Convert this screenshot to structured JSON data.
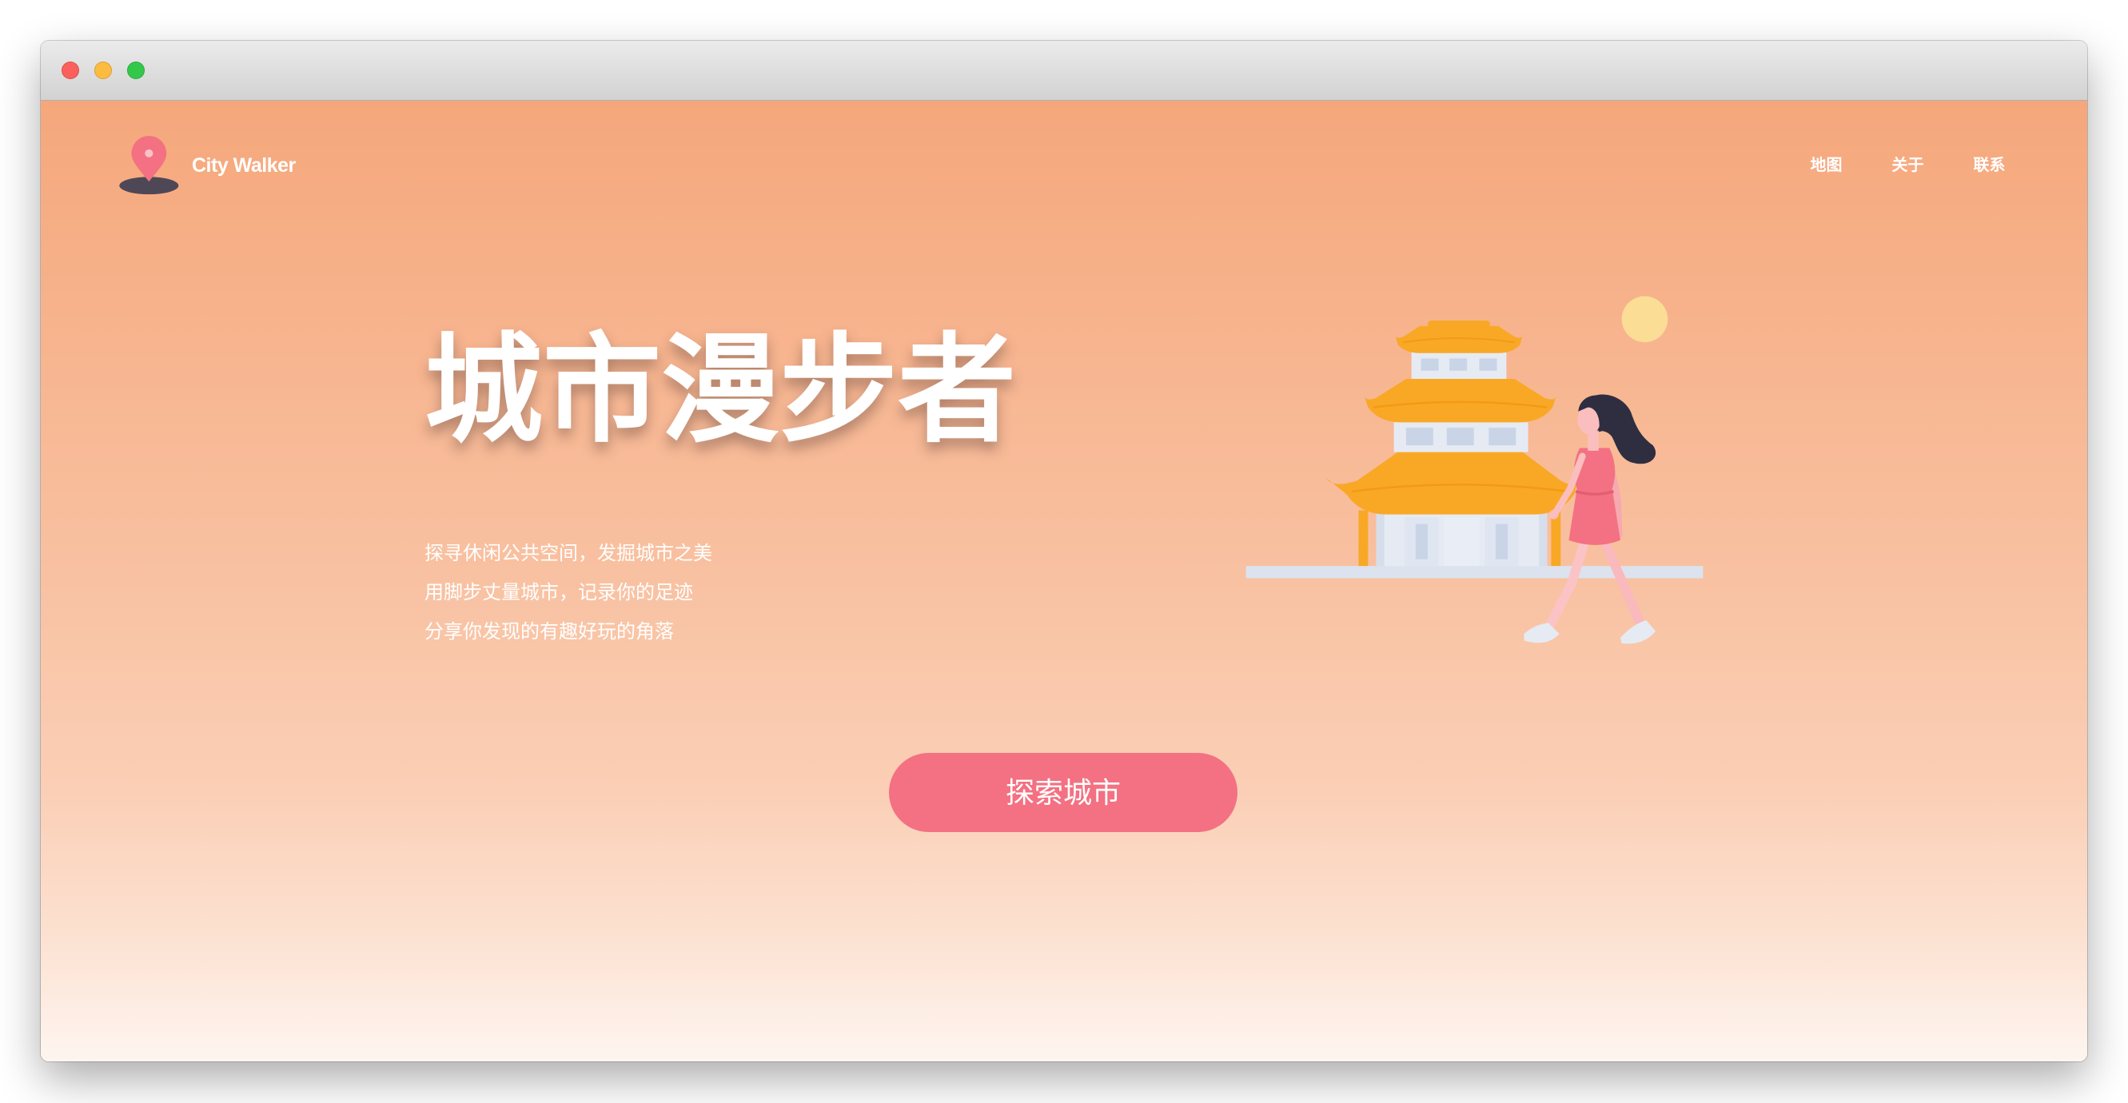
{
  "brand": {
    "name": "City Walker",
    "icon": "map-pin-icon"
  },
  "nav": {
    "items": [
      {
        "label": "地图"
      },
      {
        "label": "关于"
      },
      {
        "label": "联系"
      }
    ]
  },
  "hero": {
    "title": "城市漫步者",
    "lines": [
      "探寻休闲公共空间，发掘城市之美",
      "用脚步丈量城市，记录你的足迹",
      "分享你发现的有趣好玩的角落"
    ],
    "cta_label": "探索城市",
    "illustration": "pagoda-walker-illustration"
  },
  "colors": {
    "accent": "#f37182",
    "gradient_top": "#f5a77b",
    "gradient_bottom": "#fef5f0",
    "text": "#ffffff",
    "traffic_close": "#fc605c",
    "traffic_minimize": "#fdbc40",
    "traffic_zoom": "#34c84a"
  }
}
